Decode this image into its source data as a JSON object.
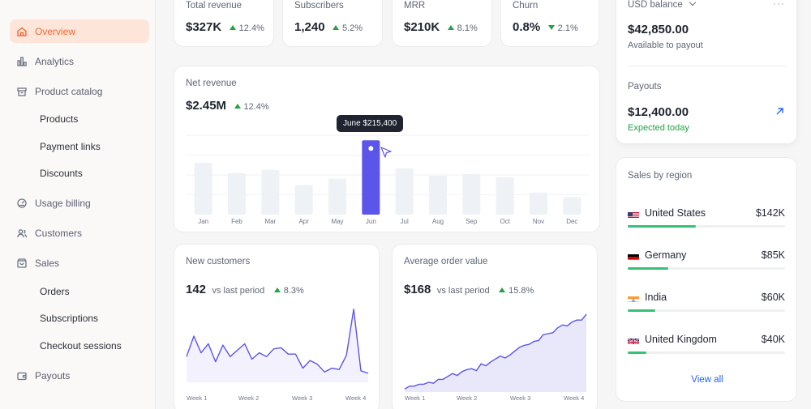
{
  "sidebar": {
    "items": [
      {
        "label": "Overview",
        "icon": "home-icon",
        "active": true
      },
      {
        "label": "Analytics",
        "icon": "bar-chart-icon"
      },
      {
        "label": "Product catalog",
        "icon": "box-icon"
      },
      {
        "label": "Products",
        "sub": true
      },
      {
        "label": "Payment links",
        "sub": true
      },
      {
        "label": "Discounts",
        "sub": true
      },
      {
        "label": "Usage billing",
        "icon": "gauge-icon"
      },
      {
        "label": "Customers",
        "icon": "users-icon"
      },
      {
        "label": "Sales",
        "icon": "bag-icon"
      },
      {
        "label": "Orders",
        "sub": true
      },
      {
        "label": "Subscriptions",
        "sub": true
      },
      {
        "label": "Checkout sessions",
        "sub": true
      },
      {
        "label": "Payouts",
        "icon": "wallet-icon"
      }
    ]
  },
  "kpis": [
    {
      "label": "Total revenue",
      "value": "$327K",
      "change": "12.4%",
      "direction": "up"
    },
    {
      "label": "Subscribers",
      "value": "1,240",
      "change": "5.2%",
      "direction": "up"
    },
    {
      "label": "MRR",
      "value": "$210K",
      "change": "8.1%",
      "direction": "up"
    },
    {
      "label": "Churn",
      "value": "0.8%",
      "change": "2.1%",
      "direction": "down"
    }
  ],
  "net_revenue": {
    "title": "Net revenue",
    "value": "$2.45M",
    "change": "12.4%",
    "tooltip": "June $215,400"
  },
  "new_customers": {
    "title": "New customers",
    "value": "142",
    "suffix": "vs last period",
    "change": "8.3%"
  },
  "avg_order": {
    "title": "Average order value",
    "value": "$168",
    "suffix": "vs last period",
    "change": "15.8%"
  },
  "balance": {
    "label": "USD balance",
    "amount": "$42,850.00",
    "sub": "Available to payout",
    "payouts_label": "Payouts",
    "payouts_amount": "$12,400.00",
    "payouts_status": "Expected today"
  },
  "regions": {
    "title": "Sales by region",
    "items": [
      {
        "name": "United States",
        "amount": "$142K",
        "share": 0.44,
        "flag": "us"
      },
      {
        "name": "Germany",
        "amount": "$85K",
        "share": 0.26,
        "flag": "de"
      },
      {
        "name": "India",
        "amount": "$60K",
        "share": 0.18,
        "flag": "in"
      },
      {
        "name": "United Kingdom",
        "amount": "$40K",
        "share": 0.12,
        "flag": "gb"
      }
    ],
    "view_all": "View all"
  },
  "colors": {
    "accent": "#ef6a35",
    "primary_bar": "#5b55ea",
    "bar": "#eef1f5",
    "positive": "#24a148",
    "link": "#2563eb"
  },
  "chart_data": [
    {
      "type": "bar",
      "categories": [
        "Jan",
        "Feb",
        "Mar",
        "Apr",
        "May",
        "Jun",
        "Jul",
        "Aug",
        "Sep",
        "Oct",
        "Nov",
        "Dec"
      ],
      "values": [
        150000,
        120000,
        130000,
        86000,
        104000,
        215400,
        134000,
        113000,
        118000,
        108000,
        64000,
        50000
      ],
      "highlight": "Jun",
      "ylim": [
        0,
        230000
      ]
    },
    {
      "type": "line",
      "categories": [
        "Week 1",
        "Week 2",
        "Week 3",
        "Week 4"
      ],
      "values": [
        20,
        36,
        23,
        30,
        16,
        29,
        20,
        25,
        30,
        18,
        23,
        20,
        26,
        27,
        22,
        22,
        11,
        17,
        14,
        8,
        11,
        10,
        21,
        57,
        9,
        7
      ],
      "ylim": [
        0,
        60
      ]
    },
    {
      "type": "area",
      "categories": [
        "Week 1",
        "Week 2",
        "Week 3",
        "Week 4"
      ],
      "values": [
        3,
        6,
        6,
        8,
        8,
        10,
        9,
        13,
        13,
        16,
        19,
        17,
        21,
        23,
        24,
        22,
        29,
        27,
        31,
        34,
        37,
        35,
        38,
        42,
        46,
        48,
        49,
        52,
        53,
        59,
        60,
        61,
        66,
        69,
        68,
        72,
        74,
        74,
        80
      ],
      "ylim": [
        0,
        85
      ]
    }
  ]
}
